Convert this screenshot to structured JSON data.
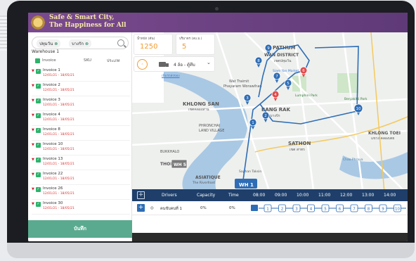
{
  "header": {
    "brand_line1": "Safe & Smart City,",
    "brand_line2": "The Happiness for All"
  },
  "filter": {
    "chips": [
      "ปทุมวัน",
      "บางรัก"
    ],
    "chip_close": "⊗"
  },
  "warehouse": {
    "title": "Warehouse 1",
    "columns": [
      "Invoice",
      "SKU",
      "ประเภท"
    ]
  },
  "invoices": [
    {
      "name": "Invoice 1",
      "date": "12/01/21 - 18/05/21"
    },
    {
      "name": "Invoice 2",
      "date": "12/01/21 - 18/05/21"
    },
    {
      "name": "Invoice 3",
      "date": "12/01/21 - 18/05/21"
    },
    {
      "name": "Invoice 4",
      "date": "12/01/21 - 18/05/21"
    },
    {
      "name": "Invoice 8",
      "date": "12/01/21 - 18/05/21"
    },
    {
      "name": "Invoice 10",
      "date": "12/01/21 - 18/05/21"
    },
    {
      "name": "Invoice 13",
      "date": "12/01/21 - 18/05/21"
    },
    {
      "name": "Invoice 22",
      "date": "12/01/21 - 18/05/21"
    },
    {
      "name": "Invoice 26",
      "date": "12/01/21 - 18/05/21"
    },
    {
      "name": "Invoice 30",
      "date": "12/01/21 - 18/05/21"
    }
  ],
  "save_label": "บันทึก",
  "cards": [
    {
      "label": "น้ำหนัก (ตัน)",
      "value": "1250"
    },
    {
      "label": "ปริมาตร (ลบ.ม.)",
      "value": "5"
    }
  ],
  "vehicle": {
    "days": "4 ล้อ - ตู้ทึบ",
    "link": "เพิ่มรถส่งของ"
  },
  "map": {
    "districts": [
      "PATHUM",
      "WAN DISTRICT",
      "เขตปทุมวัน",
      "KHLONG SAN",
      "เขตคลองสาน",
      "BANG RAK",
      "เขตบางรัก",
      "SATHON",
      "เขต สาทร",
      "KHLONG TOEI",
      "แขวง คลองเตย",
      "PHRONCHAI",
      "LAND VILLAGE",
      "BUKKHALO",
      "THON BURI",
      "ASIATIQUE",
      "The Riverfront",
      "Wat Traimit",
      "Phayaram Worawihan",
      "Lumphini Park",
      "Benjakitti Park",
      "Siam Yan Market",
      "Saphan Taksin",
      "Chao Phraya"
    ],
    "warehouse_labels": [
      "WH 5",
      "WH 1"
    ],
    "markers": [
      "1",
      "2",
      "3",
      "4",
      "5",
      "6",
      "7",
      "8",
      "9",
      "10"
    ]
  },
  "timeline": {
    "headers": [
      "Drivers",
      "Capacity",
      "Time",
      "08:00",
      "09:00",
      "10:00",
      "11:00",
      "12:00",
      "13:00",
      "14:00"
    ],
    "row": {
      "driver": "คนขับคนที่ 1",
      "capacity": "0%",
      "time": "0%"
    },
    "stops": [
      "1",
      "2",
      "3",
      "4",
      "5",
      "6",
      "7",
      "8",
      "9",
      "10"
    ]
  },
  "colors": {
    "header": "#6a4283",
    "accent": "#f39a2c",
    "route": "#2e6db5",
    "save": "#5aaa8f",
    "timeline": "#1f3f6a"
  }
}
